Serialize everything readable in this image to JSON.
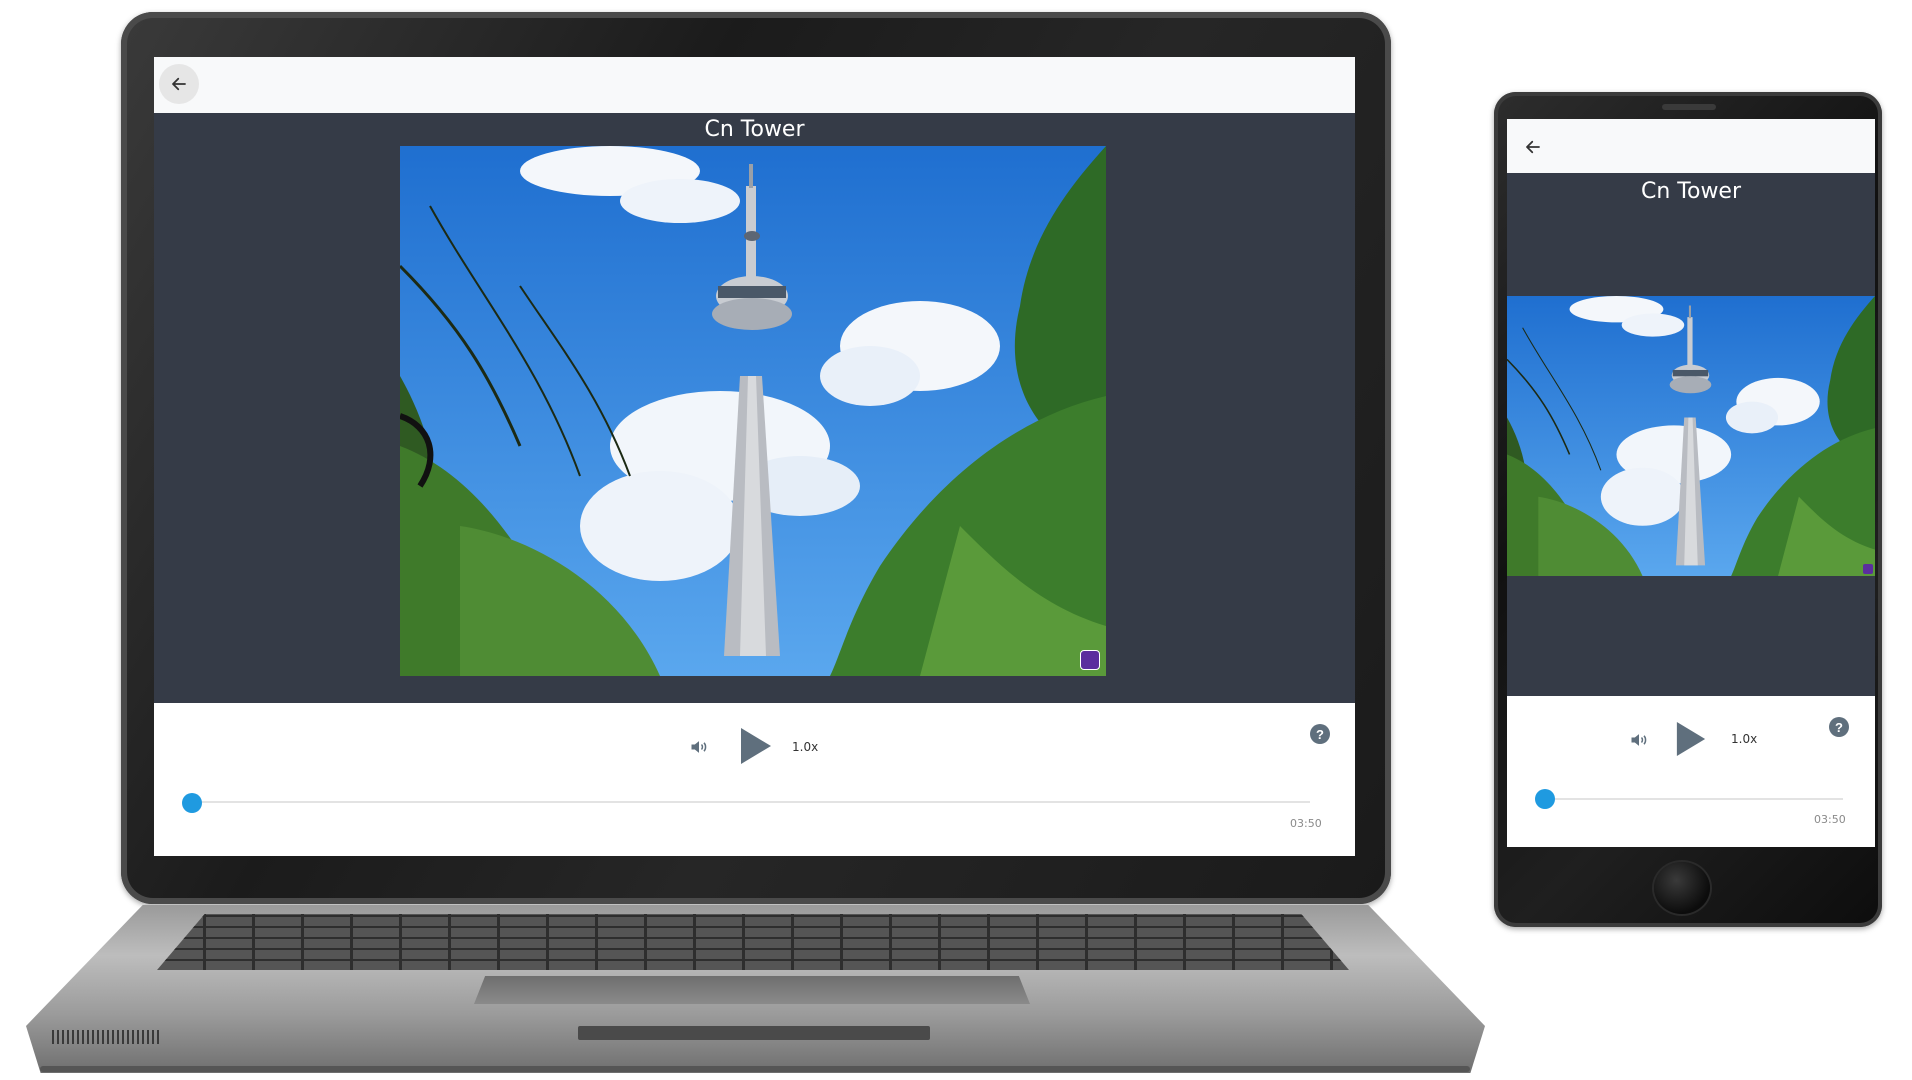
{
  "lesson": {
    "title": "Cn Tower"
  },
  "player": {
    "speed": "1.0x",
    "duration": "03:50",
    "progress": 0,
    "help_label": "?"
  },
  "icons": {
    "back": "arrow-left-icon",
    "volume": "speaker-icon",
    "play": "play-icon",
    "help": "question-circle-icon",
    "watermark": "brand-badge-icon"
  },
  "colors": {
    "stage": "#353b47",
    "accent": "#1f9ae0",
    "icon": "#5f6f7d",
    "header": "#f8f9fa"
  }
}
